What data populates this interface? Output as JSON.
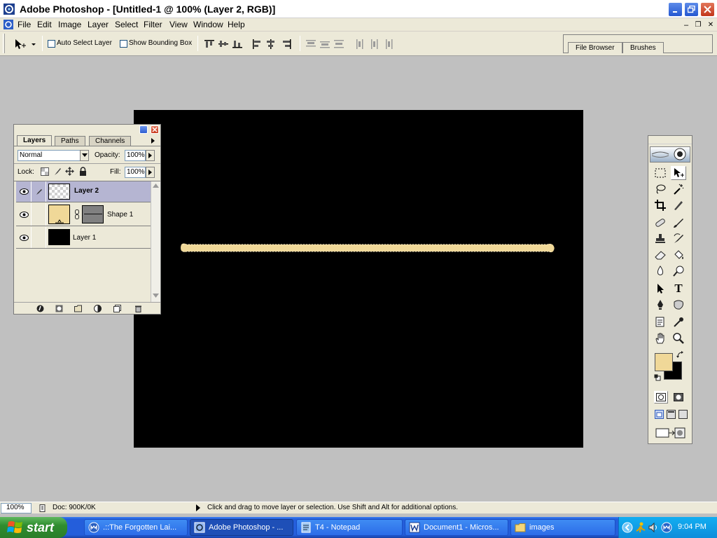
{
  "window": {
    "title": "Adobe Photoshop - [Untitled-1 @ 100% (Layer 2, RGB)]",
    "minimize_glyph": "_",
    "maximize_glyph": "❐",
    "close_glyph": "✕"
  },
  "menubar": {
    "items": [
      "File",
      "Edit",
      "Image",
      "Layer",
      "Select",
      "Filter",
      "View",
      "Window",
      "Help"
    ],
    "doc_minimize": "–",
    "doc_restore": "❐",
    "doc_close": "✕"
  },
  "options": {
    "auto_select_label": "Auto Select Layer",
    "auto_select_checked": false,
    "bounding_box_label": "Show Bounding Box",
    "bounding_box_checked": false,
    "palette_well_tabs": [
      "File Browser",
      "Brushes"
    ]
  },
  "layers_palette": {
    "tabs": [
      "Layers",
      "Paths",
      "Channels"
    ],
    "active_tab": "Layers",
    "blend_mode": "Normal",
    "opacity_label": "Opacity:",
    "opacity": "100%",
    "lock_label": "Lock:",
    "fill_label": "Fill:",
    "fill": "100%",
    "layers": [
      {
        "name": "Layer 2",
        "selected": true,
        "thumb": "transparent"
      },
      {
        "name": "Shape 1",
        "selected": false,
        "thumb": "fill",
        "fill_color": "#f0d898",
        "has_mask": true
      },
      {
        "name": "Layer 1",
        "selected": false,
        "thumb": "black"
      }
    ]
  },
  "canvas": {
    "background": "#000000",
    "stroke_color": "#f0d898"
  },
  "toolbox": {
    "foreground_color": "#f0d898",
    "background_color": "#000000",
    "type_tool_glyph": "T"
  },
  "statusbar": {
    "zoom": "100%",
    "doc_info": "Doc: 900K/0K",
    "hint": "Click and drag to move layer or selection.  Use Shift and Alt for additional options."
  },
  "taskbar": {
    "start_label": "start",
    "tasks": [
      {
        "label": ".::The Forgotten Lai...",
        "icon": "browser-icon",
        "active": false
      },
      {
        "label": "Adobe Photoshop - ...",
        "icon": "photoshop-icon",
        "active": true
      },
      {
        "label": "T4 - Notepad",
        "icon": "notepad-icon",
        "active": false
      },
      {
        "label": "Document1 - Micros...",
        "icon": "word-icon",
        "active": false
      },
      {
        "label": "images",
        "icon": "folder-icon",
        "active": false
      }
    ],
    "clock": "9:04 PM"
  }
}
